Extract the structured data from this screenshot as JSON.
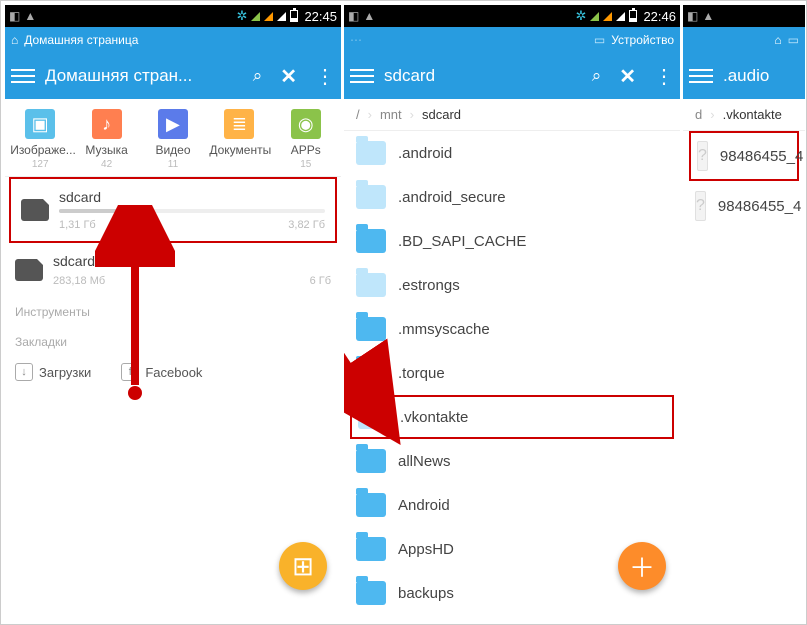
{
  "screen1": {
    "status": {
      "time": "22:45"
    },
    "topstrip": {
      "text": "Домашняя страница"
    },
    "header": {
      "title": "Домашняя стран..."
    },
    "categories": [
      {
        "label": "Изображе...",
        "count": "127",
        "cls": "img"
      },
      {
        "label": "Музыка",
        "count": "42",
        "cls": "mus"
      },
      {
        "label": "Видео",
        "count": "11",
        "cls": "vid"
      },
      {
        "label": "Документы",
        "count": "",
        "cls": "doc"
      },
      {
        "label": "APPs",
        "count": "15",
        "cls": "app"
      }
    ],
    "storage": [
      {
        "name": "sdcard",
        "used": "1,31 Гб",
        "total": "3,82 Гб",
        "highlight": true
      },
      {
        "name": "sdcard2",
        "used": "283,18 Мб",
        "total": "6 Гб",
        "highlight": false
      }
    ],
    "sections": {
      "tools": "Инструменты",
      "bookmarks": "Закладки"
    },
    "bookmarks": [
      {
        "label": "Загрузки"
      },
      {
        "label": "Facebook"
      }
    ]
  },
  "screen2": {
    "status": {
      "time": "22:46"
    },
    "topstrip": {
      "text": "Устройство"
    },
    "header": {
      "title": "sdcard"
    },
    "crumbs": [
      "/",
      "mnt",
      "sdcard"
    ],
    "folders": [
      {
        "name": ".android",
        "faded": true
      },
      {
        "name": ".android_secure",
        "faded": true
      },
      {
        "name": ".BD_SAPI_CACHE"
      },
      {
        "name": ".estrongs",
        "faded": true
      },
      {
        "name": ".mmsyscache"
      },
      {
        "name": ".torque"
      },
      {
        "name": ".vkontakte",
        "highlight": true,
        "faded": true
      },
      {
        "name": "allNews"
      },
      {
        "name": "Android"
      },
      {
        "name": "AppsHD"
      },
      {
        "name": "backups"
      }
    ]
  },
  "screen3": {
    "header": {
      "title": ".audio"
    },
    "crumbs_visible": [
      "d",
      ".vkontakte"
    ],
    "files": [
      {
        "name": "98486455_4",
        "highlight": true
      },
      {
        "name": "98486455_4"
      }
    ]
  }
}
